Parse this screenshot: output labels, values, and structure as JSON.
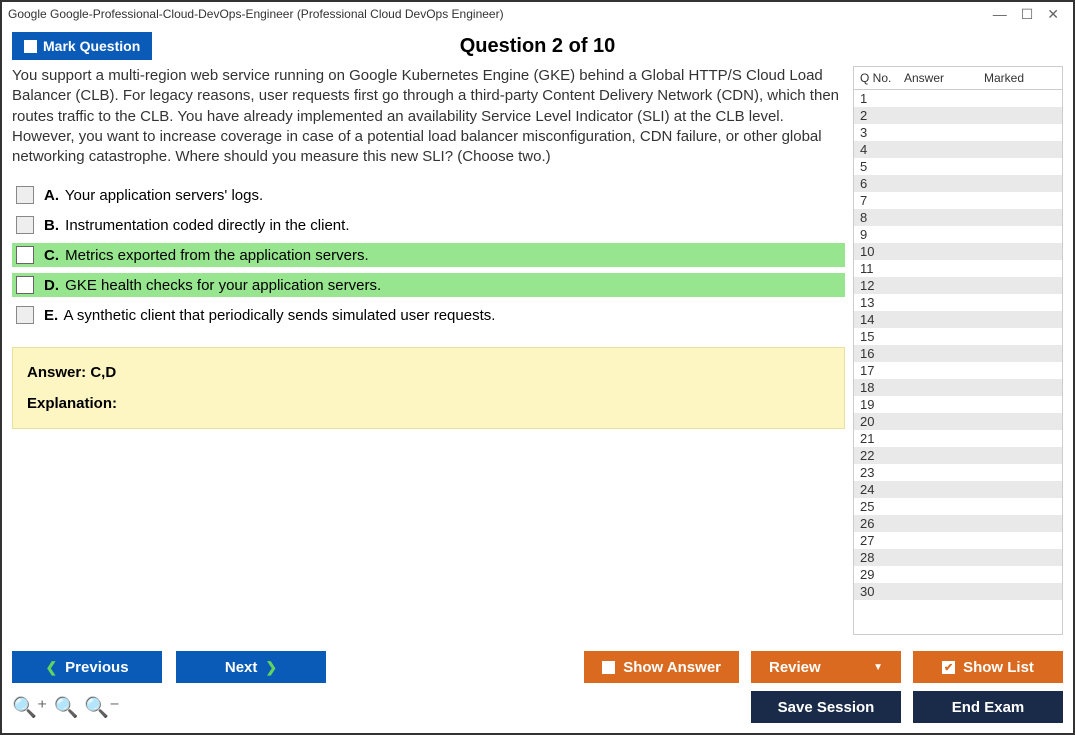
{
  "window": {
    "title": "Google Google-Professional-Cloud-DevOps-Engineer (Professional Cloud DevOps Engineer)"
  },
  "header": {
    "mark_label": "Mark Question",
    "question_title": "Question 2 of 10"
  },
  "question": {
    "text": "You support a multi-region web service running on Google Kubernetes Engine (GKE) behind a Global HTTP/S Cloud Load Balancer (CLB). For legacy reasons, user requests first go through a third-party Content Delivery Network (CDN), which then routes traffic to the CLB. You have already implemented an availability Service Level Indicator (SLI) at the CLB level. However, you want to increase coverage in case of a potential load balancer misconfiguration, CDN failure, or other global networking catastrophe. Where should you measure this new SLI? (Choose two.)"
  },
  "options": [
    {
      "letter": "A.",
      "text": "Your application servers' logs.",
      "correct": false
    },
    {
      "letter": "B.",
      "text": "Instrumentation coded directly in the client.",
      "correct": false
    },
    {
      "letter": "C.",
      "text": "Metrics exported from the application servers.",
      "correct": true
    },
    {
      "letter": "D.",
      "text": "GKE health checks for your application servers.",
      "correct": true
    },
    {
      "letter": "E.",
      "text": "A synthetic client that periodically sends simulated user requests.",
      "correct": false
    }
  ],
  "answer_panel": {
    "answer_label": "Answer: C,D",
    "explanation_label": "Explanation:"
  },
  "sidebar": {
    "col_qno": "Q No.",
    "col_answer": "Answer",
    "col_marked": "Marked",
    "rows": [
      {
        "n": "1"
      },
      {
        "n": "2"
      },
      {
        "n": "3"
      },
      {
        "n": "4"
      },
      {
        "n": "5"
      },
      {
        "n": "6"
      },
      {
        "n": "7"
      },
      {
        "n": "8"
      },
      {
        "n": "9"
      },
      {
        "n": "10"
      },
      {
        "n": "11"
      },
      {
        "n": "12"
      },
      {
        "n": "13"
      },
      {
        "n": "14"
      },
      {
        "n": "15"
      },
      {
        "n": "16"
      },
      {
        "n": "17"
      },
      {
        "n": "18"
      },
      {
        "n": "19"
      },
      {
        "n": "20"
      },
      {
        "n": "21"
      },
      {
        "n": "22"
      },
      {
        "n": "23"
      },
      {
        "n": "24"
      },
      {
        "n": "25"
      },
      {
        "n": "26"
      },
      {
        "n": "27"
      },
      {
        "n": "28"
      },
      {
        "n": "29"
      },
      {
        "n": "30"
      }
    ]
  },
  "footer": {
    "previous": "Previous",
    "next": "Next",
    "show_answer": "Show Answer",
    "review": "Review",
    "show_list": "Show List",
    "save_session": "Save Session",
    "end_exam": "End Exam"
  }
}
